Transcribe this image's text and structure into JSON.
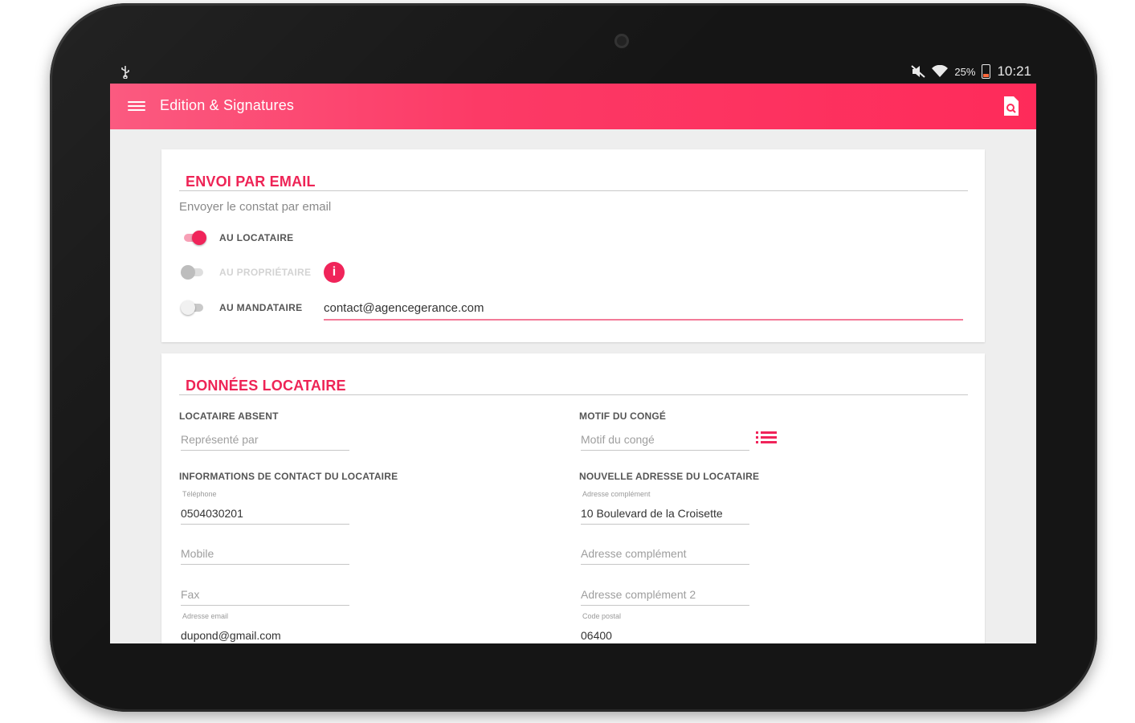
{
  "status_bar": {
    "battery": "25%",
    "time": "10:21"
  },
  "app_bar": {
    "title": "Edition & Signatures"
  },
  "email_section": {
    "title": "ENVOI PAR EMAIL",
    "subtitle": "Envoyer le constat par email",
    "toggles": [
      {
        "label": "AU LOCATAIRE",
        "state": "on"
      },
      {
        "label": "AU PROPRIÉTAIRE",
        "state": "disabled"
      },
      {
        "label": "AU MANDATAIRE",
        "state": "off"
      }
    ],
    "mandataire_email": "contact@agencegerance.com"
  },
  "tenant_section": {
    "title": "DONNÉES LOCATAIRE",
    "absent_label": "LOCATAIRE ABSENT",
    "represented_placeholder": "Représenté par",
    "leave_reason_label": "MOTIF DU CONGÉ",
    "leave_reason_placeholder": "Motif du congé",
    "contact_label": "INFORMATIONS DE CONTACT DU LOCATAIRE",
    "phone_label": "Téléphone",
    "phone_value": "0504030201",
    "mobile_placeholder": "Mobile",
    "fax_placeholder": "Fax",
    "email_label": "Adresse email",
    "email_value": "dupond@gmail.com",
    "new_address_label": "NOUVELLE ADRESSE DU LOCATAIRE",
    "address_label": "Adresse complément",
    "address_value": "10 Boulevard de la Croisette",
    "address2_placeholder": "Adresse complément",
    "address3_placeholder": "Adresse complément 2",
    "postal_label": "Code postal",
    "postal_value": "06400"
  },
  "colors": {
    "accent": "#f0245a",
    "app_bar": "#fe2b5a"
  }
}
